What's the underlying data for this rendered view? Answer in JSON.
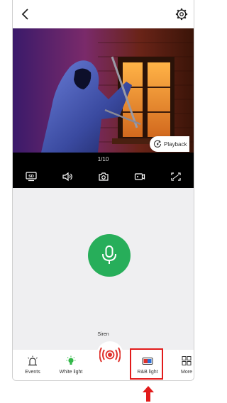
{
  "player": {
    "page_indicator": "1/10"
  },
  "controls": [
    {
      "name": "sd-quality-button",
      "icon": "sd-icon"
    },
    {
      "name": "speaker-button",
      "icon": "speaker-icon"
    },
    {
      "name": "snapshot-button",
      "icon": "camera-icon"
    },
    {
      "name": "record-button",
      "icon": "video-record-icon"
    },
    {
      "name": "fullscreen-button",
      "icon": "fullscreen-icon"
    }
  ],
  "sd_label": "SD",
  "siren": {
    "label": "Siren"
  },
  "playback": {
    "label": "Playback"
  },
  "tabs": [
    {
      "label": "Events"
    },
    {
      "label": "White light"
    },
    {
      "label": "R&B light"
    },
    {
      "label": "More"
    }
  ],
  "colors": {
    "accent_green": "#27ae5a",
    "siren_red": "#e0312b",
    "highlight_red": "#e21b1b",
    "white_light_green": "#34b84a"
  }
}
